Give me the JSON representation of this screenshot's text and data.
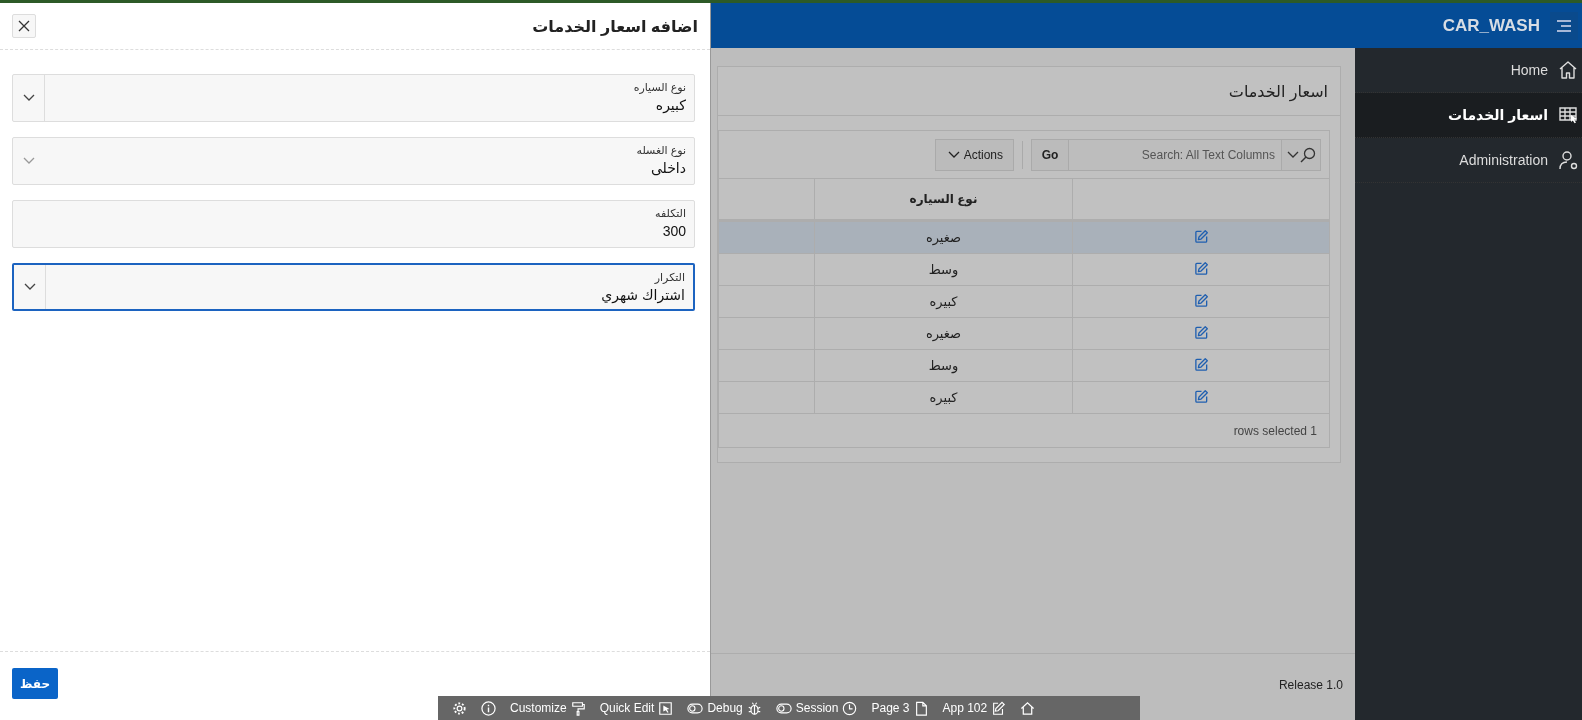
{
  "dialog": {
    "title": "اضافه اسعار الخدمات",
    "fields": [
      {
        "kind": "select",
        "label": "نوع السياره",
        "value": "كبيره",
        "focused": false
      },
      {
        "kind": "list",
        "label": "نوع الغسله",
        "value": "داخلى",
        "focused": false
      },
      {
        "kind": "text",
        "label": "التكلفه",
        "value": "300",
        "focused": false
      },
      {
        "kind": "select",
        "label": "التكرار",
        "value": "اشتراك شهري",
        "focused": true
      }
    ],
    "save_button": "حفظ"
  },
  "header": {
    "app_name": "CAR_WASH"
  },
  "sidebar": {
    "items": [
      {
        "label": "Home",
        "selected": false
      },
      {
        "label": "اسعار الخدمات",
        "selected": true
      },
      {
        "label": "Administration",
        "selected": false
      }
    ]
  },
  "region": {
    "title": "اسعار الخدمات",
    "search": {
      "placeholder": "Search: All Text Columns"
    },
    "go_button": "Go",
    "actions_button": "Actions",
    "table": {
      "columns": [
        "نوع السياره"
      ],
      "rows": [
        {
          "cell": "صغيره",
          "selected": true
        },
        {
          "cell": "وسط",
          "selected": false
        },
        {
          "cell": "كبيره",
          "selected": false
        },
        {
          "cell": "صغيره",
          "selected": false
        },
        {
          "cell": "وسط",
          "selected": false
        },
        {
          "cell": "كبيره",
          "selected": false
        }
      ]
    },
    "footer": "rows selected 1"
  },
  "page_footer": "Release 1.0",
  "dev_toolbar": {
    "customize": "Customize",
    "quick_edit": "Quick Edit",
    "debug": "Debug",
    "session": "Session",
    "page": "Page 3",
    "app": "App 102"
  }
}
